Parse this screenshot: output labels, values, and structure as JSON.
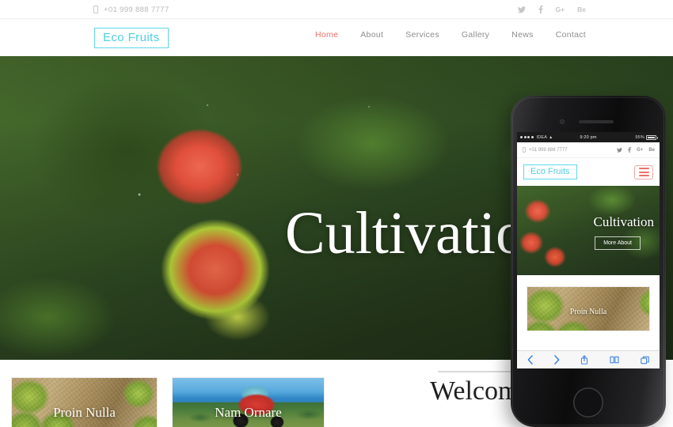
{
  "site": {
    "brand": "Eco Fruits",
    "phone": "+01 999 888 7777"
  },
  "topbar": {
    "phone": "+01 999 888 7777",
    "social": [
      {
        "name": "twitter-icon",
        "label": "t"
      },
      {
        "name": "facebook-icon",
        "label": "f"
      },
      {
        "name": "google-plus-icon",
        "label": "G+"
      },
      {
        "name": "behance-icon",
        "label": "Be"
      }
    ]
  },
  "nav": {
    "items": [
      {
        "label": "Home",
        "active": true
      },
      {
        "label": "About",
        "active": false
      },
      {
        "label": "Services",
        "active": false
      },
      {
        "label": "Gallery",
        "active": false
      },
      {
        "label": "News",
        "active": false
      },
      {
        "label": "Contact",
        "active": false
      }
    ]
  },
  "hero": {
    "title": "Cultivation"
  },
  "cards": [
    {
      "caption": "Proin Nulla"
    },
    {
      "caption": "Nam Ornare"
    }
  ],
  "welcome": {
    "title": "Welcome"
  },
  "phone_mockup": {
    "statusbar": {
      "carrier": "IDEA",
      "wifi": "▴",
      "time": "9:20 pm",
      "battery_pct": "95%"
    },
    "topbar": {
      "phone": "+01 999 888 7777",
      "social": [
        {
          "name": "twitter-icon",
          "label": "t"
        },
        {
          "name": "facebook-icon",
          "label": "f"
        },
        {
          "name": "google-plus-icon",
          "label": "G+"
        },
        {
          "name": "behance-icon",
          "label": "Be"
        }
      ]
    },
    "brand": "Eco Fruits",
    "menu_icon": "hamburger-icon",
    "hero": {
      "title": "Cultivation",
      "button": "More About"
    },
    "card": {
      "caption": "Proin Nulla"
    },
    "browser_toolbar": [
      {
        "name": "back-icon",
        "glyph": "‹"
      },
      {
        "name": "forward-icon",
        "glyph": "›"
      },
      {
        "name": "share-icon",
        "glyph": "⬆"
      },
      {
        "name": "bookmarks-icon",
        "glyph": "□"
      },
      {
        "name": "tabs-icon",
        "glyph": "❐"
      }
    ]
  },
  "colors": {
    "accent_cyan": "#4fcfe2",
    "accent_red": "#ee6f6a",
    "toolbar_blue": "#2f7de1",
    "muted_text": "#8d8d8d"
  }
}
